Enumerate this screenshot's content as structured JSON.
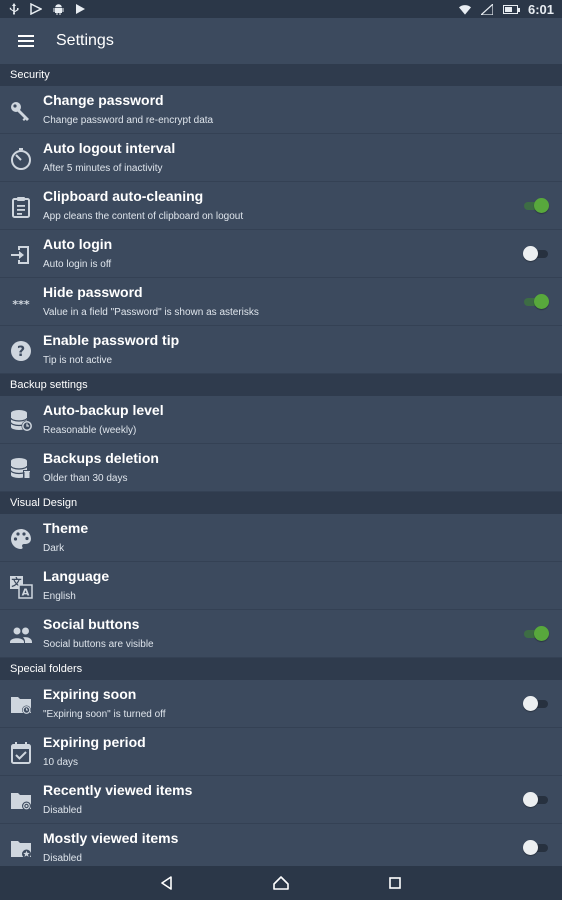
{
  "statusbar": {
    "time": "6:01",
    "left_icons": [
      "usb-icon",
      "notification-icon",
      "android-icon",
      "play-store-icon"
    ],
    "right_icons": [
      "wifi-icon",
      "signal-icon",
      "battery-icon"
    ],
    "battery_level": 0.65
  },
  "toolbar": {
    "title": "Settings",
    "menu_icon": "hamburger-menu-icon"
  },
  "sections": [
    {
      "title": "Security",
      "items": [
        {
          "title": "Change password",
          "subtitle": "Change password and re-encrypt data",
          "icon": "key-icon"
        },
        {
          "title": "Auto logout interval",
          "subtitle": "After 5 minutes of inactivity",
          "icon": "timer-icon"
        },
        {
          "title": "Clipboard auto-cleaning",
          "subtitle": "App cleans the content of clipboard on logout",
          "icon": "clipboard-icon",
          "toggle": true
        },
        {
          "title": "Auto login",
          "subtitle": "Auto login is off",
          "icon": "login-icon",
          "toggle": false
        },
        {
          "title": "Hide password",
          "subtitle": "Value in a field \"Password\" is shown as asterisks",
          "icon": "asterisks-icon",
          "toggle": true
        },
        {
          "title": "Enable password tip",
          "subtitle": "Tip is not active",
          "icon": "help-icon"
        }
      ]
    },
    {
      "title": "Backup settings",
      "items": [
        {
          "title": "Auto-backup level",
          "subtitle": "Reasonable (weekly)",
          "icon": "database-clock-icon"
        },
        {
          "title": "Backups deletion",
          "subtitle": "Older than 30 days",
          "icon": "database-delete-icon"
        }
      ]
    },
    {
      "title": "Visual Design",
      "items": [
        {
          "title": "Theme",
          "subtitle": "Dark",
          "icon": "palette-icon"
        },
        {
          "title": "Language",
          "subtitle": "English",
          "icon": "translate-icon"
        },
        {
          "title": "Social buttons",
          "subtitle": "Social buttons are visible",
          "icon": "people-icon",
          "toggle": true
        }
      ]
    },
    {
      "title": "Special folders",
      "items": [
        {
          "title": "Expiring soon",
          "subtitle": "\"Expiring soon\" is turned off",
          "icon": "folder-clock-icon",
          "toggle": false
        },
        {
          "title": "Expiring period",
          "subtitle": "10 days",
          "icon": "calendar-check-icon"
        },
        {
          "title": "Recently viewed items",
          "subtitle": "Disabled",
          "icon": "folder-eye-icon",
          "toggle": false
        },
        {
          "title": "Mostly viewed items",
          "subtitle": "Disabled",
          "icon": "folder-star-icon",
          "toggle": false
        }
      ]
    }
  ],
  "navbar": {
    "buttons": [
      "back-icon",
      "home-icon",
      "recents-icon"
    ]
  },
  "colors": {
    "background": "#3c4a5e",
    "section_header": "#2f3b4d",
    "toggle_on": "#58a83c",
    "toggle_off": "#eceff1"
  }
}
